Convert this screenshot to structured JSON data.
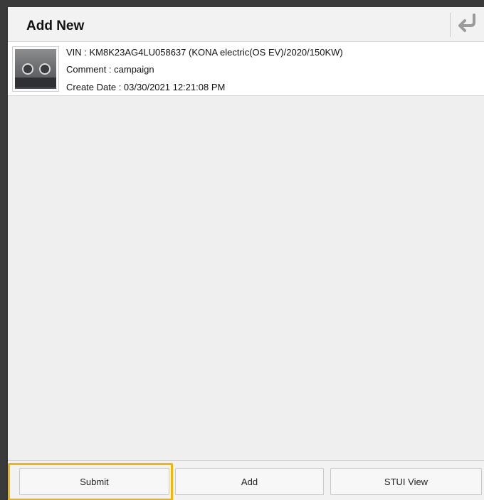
{
  "dialog": {
    "title": "Add New"
  },
  "record": {
    "vin_line": "VIN : KM8K23AG4LU058637 (KONA electric(OS EV)/2020/150KW)",
    "comment_line": "Comment : campaign",
    "create_date_line": "Create Date : 03/30/2021 12:21:08 PM"
  },
  "footer": {
    "submit_label": "Submit",
    "add_label": "Add",
    "stui_view_label": "STUI View"
  },
  "colors": {
    "highlight": "#f5b400",
    "back_arrow": "#9a9a9a"
  },
  "icons": {
    "back": "back-arrow-icon",
    "thumbnail": "vehicle-dashboard-thumbnail"
  }
}
